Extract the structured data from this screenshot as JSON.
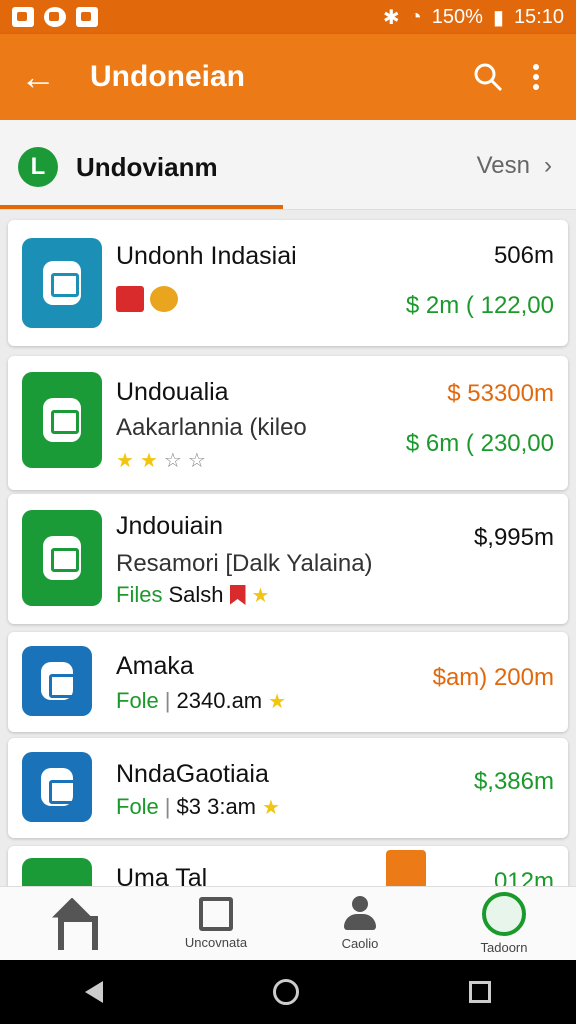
{
  "status_bar": {
    "battery": "150%",
    "time": "15:10"
  },
  "app_bar": {
    "title": "Undoneian"
  },
  "tab": {
    "label": "Undovianm",
    "right_label": "Vesn",
    "logo_letter": "L"
  },
  "items": [
    {
      "title": "Undonh Indasiai",
      "right_top": "506m",
      "price": "$ 2m ( 122,00"
    },
    {
      "title": "Undoualia",
      "subtitle": "Aakarlannia (kileo",
      "right_top": "$ 53300m",
      "price": "$ 6m ( 230,00",
      "rating": "2 of 4 stars"
    },
    {
      "title": "Jndouiain",
      "subtitle": "Resamori [Dalk Yalaina)",
      "right_top": "$,995m",
      "tag": "Files",
      "meta": "Salsh"
    },
    {
      "title": "Amaka",
      "tag": "Fole",
      "meta": "2340.am",
      "right_top": "$am) 200m"
    },
    {
      "title": "NndaGaotiaia",
      "tag": "Fole",
      "meta": "$3 3:am",
      "right_top": "$,386m"
    },
    {
      "title": "Uma Tal",
      "right_top": "012m"
    }
  ],
  "bottom_nav": {
    "items": [
      {
        "label": "",
        "icon": "home-icon"
      },
      {
        "label": "Uncovnata",
        "icon": "grid-icon"
      },
      {
        "label": "Caolio",
        "icon": "person-icon"
      },
      {
        "label": "Tadoorn",
        "icon": "gauge-icon"
      }
    ]
  },
  "colors": {
    "primary": "#ec7a16",
    "statusbar": "#e2680c",
    "green": "#1b9a2c",
    "blue": "#1a73b8"
  }
}
